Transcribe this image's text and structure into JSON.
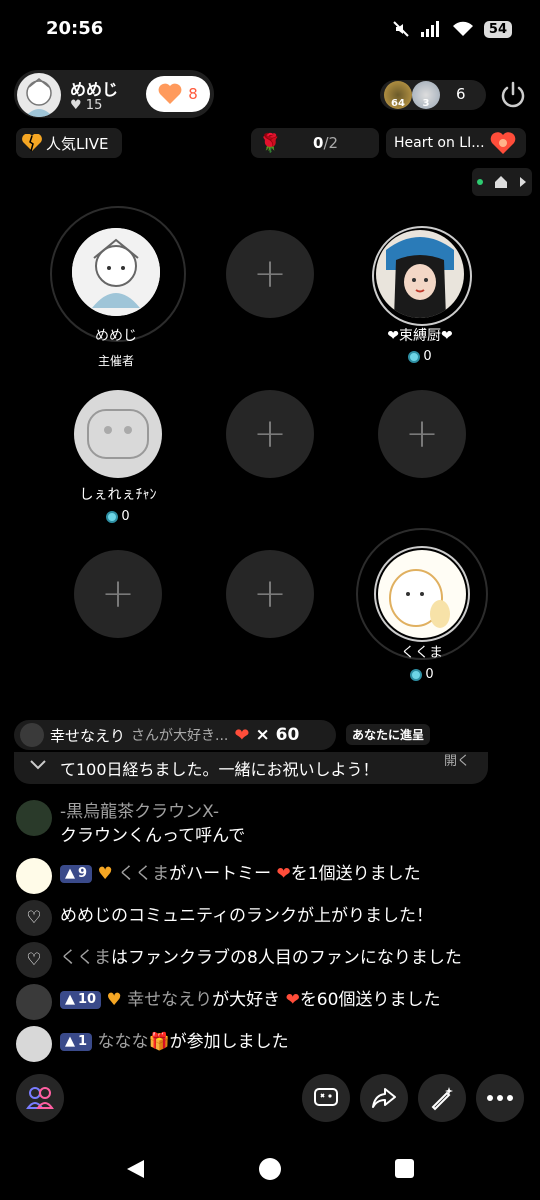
{
  "status_bar": {
    "time": "20:56",
    "battery": "54"
  },
  "host": {
    "name": "めめじ",
    "likes": "15",
    "hearts": "8"
  },
  "viewers": {
    "badge1_level": "64",
    "badge2_level": "3",
    "count": "6"
  },
  "popular_live_label": "人気LIVE",
  "rose_counter": {
    "current": "0",
    "sep": "/2"
  },
  "heart_on_live_label": "Heart on LI...",
  "seats": [
    {
      "name": "めめじ",
      "role": "主催者"
    },
    {
      "name": "❤束縛厨❤",
      "score": "0"
    },
    {
      "name": "しぇれぇﾁｬﾝ",
      "score": "0"
    },
    {
      "name": "くくま",
      "score": "0"
    }
  ],
  "banner": {
    "user": "幸せなえり",
    "text": "さんが大好き...",
    "multiplier": "× 60",
    "tag": "あなたに進呈"
  },
  "anniversary_text": "て100日経ちました。一緒にお祝いしよう！",
  "anniversary_open": "開く",
  "chat": [
    {
      "user": "-黒烏龍茶クラウンX-",
      "message": "クラウンくんって呼んで"
    },
    {
      "level": "9",
      "user": "くくま",
      "text_a": "がハートミー",
      "text_b": "を1個送りました"
    },
    {
      "text": "めめじのコミュニティのランクが上がりました！"
    },
    {
      "user": "くくま",
      "text": "はファンクラブの8人目のファンになりました"
    },
    {
      "level": "10",
      "user": "幸せなえり",
      "text_a": "が大好き",
      "text_b": "を60個送りました"
    },
    {
      "level": "1",
      "user": "ななな",
      "text": "が参加しました"
    }
  ],
  "colors": {
    "accent": "#ff5a3c",
    "level_badge": "#3a4a8a",
    "gem": "#6dd5e6"
  }
}
